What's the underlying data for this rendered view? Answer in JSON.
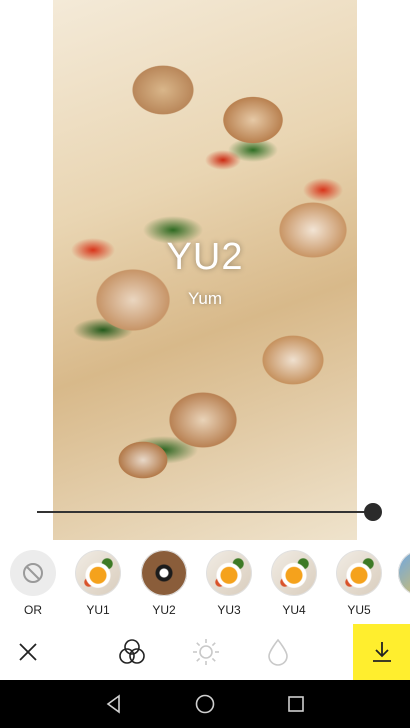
{
  "photo": {
    "filter_name": "YU2",
    "filter_subtitle": "Yum"
  },
  "intensity_slider": {
    "value": 1.0
  },
  "filters": [
    {
      "label": "OR",
      "icon": "no-filter-icon"
    },
    {
      "label": "YU1"
    },
    {
      "label": "YU2",
      "selected": true
    },
    {
      "label": "YU3"
    },
    {
      "label": "YU4"
    },
    {
      "label": "YU5"
    }
  ],
  "toolbar": {
    "items": [
      "close-icon",
      "filters-icon",
      "brightness-icon",
      "drop-icon",
      "download-icon"
    ],
    "accent_color": "#ffee2e"
  },
  "navigation_bar": {
    "items": [
      "back-icon",
      "home-icon",
      "recents-icon"
    ]
  }
}
